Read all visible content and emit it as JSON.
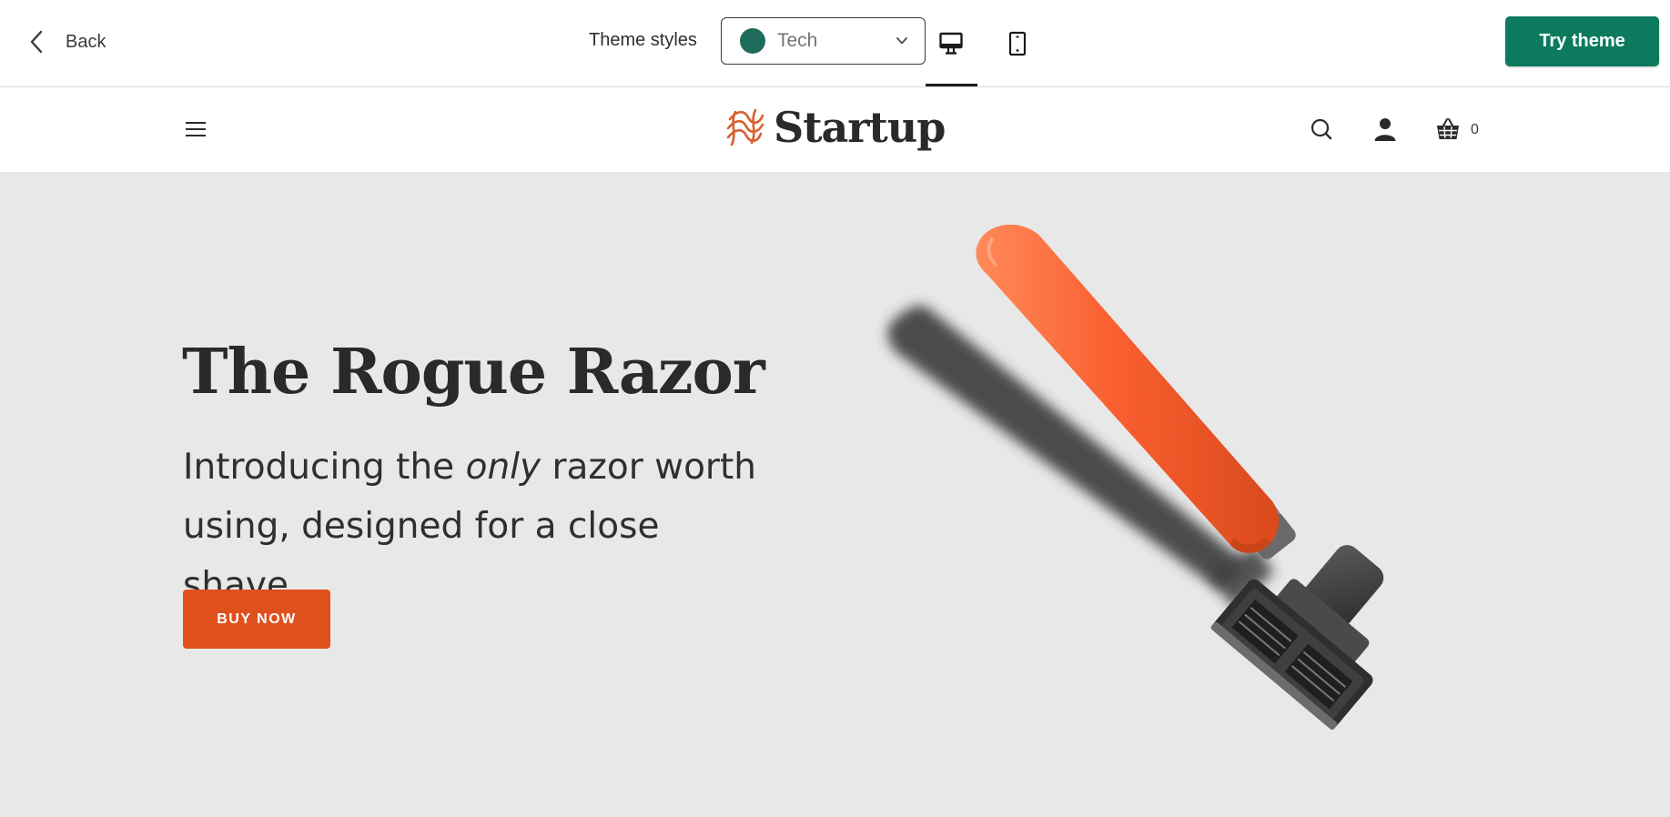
{
  "toolbar": {
    "back_label": "Back",
    "theme_styles_label": "Theme styles",
    "theme_select": {
      "value": "Tech",
      "swatch_color": "#1f6b5c"
    },
    "view_modes": [
      "desktop",
      "mobile"
    ],
    "active_view": "desktop",
    "try_theme_label": "Try theme",
    "try_theme_color": "#0b7a5e"
  },
  "store_header": {
    "logo_text": "Startup",
    "logo_mark_color": "#d9602e",
    "cart_count": "0",
    "icons": [
      "menu-icon",
      "search-icon",
      "account-icon",
      "cart-icon"
    ]
  },
  "hero": {
    "title": "The Rogue Razor",
    "subtitle_before": "Introducing the ",
    "subtitle_emphasis": "only",
    "subtitle_after": " razor worth using, designed for a close shave.",
    "cta_label": "BUY NOW",
    "cta_color": "#e0501d",
    "background_color": "#e9e8e8"
  }
}
